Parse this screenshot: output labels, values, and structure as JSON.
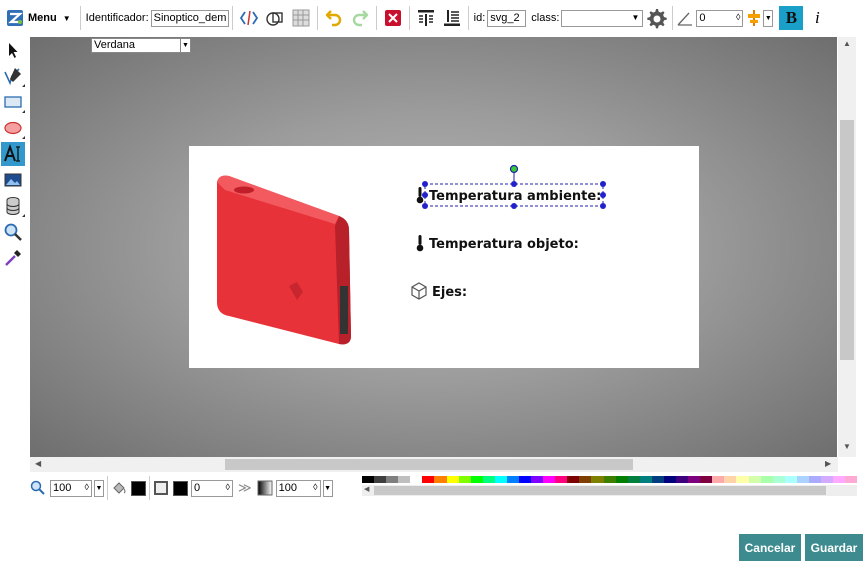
{
  "toolbar": {
    "menu_label": "Menu",
    "identifier_label": "Identificador:",
    "identifier_value": "Sinoptico_demo",
    "id_label": "id:",
    "id_value": "svg_2",
    "class_label": "class:",
    "class_value": "",
    "angle_value": "0",
    "bold_label": "B",
    "italic_label": "i"
  },
  "workarea": {
    "font_family": "Verdana"
  },
  "canvas": {
    "labels": {
      "ambient": "Temperatura ambiente:",
      "object": "Temperatura objeto:",
      "axes": "Ejes:"
    }
  },
  "bottombar": {
    "zoom_value": "100",
    "stroke_width_value": "0",
    "opacity_value": "100"
  },
  "palette": [
    "#000000",
    "#3f3f3f",
    "#7f7f7f",
    "#bfbfbf",
    "#ffffff",
    "#ff0000",
    "#ff7f00",
    "#ffff00",
    "#7fff00",
    "#00ff00",
    "#00ff7f",
    "#00ffff",
    "#007fff",
    "#0000ff",
    "#7f00ff",
    "#ff00ff",
    "#ff007f",
    "#7f0000",
    "#7f3f00",
    "#7f7f00",
    "#3f7f00",
    "#007f00",
    "#007f3f",
    "#007f7f",
    "#003f7f",
    "#00007f",
    "#3f007f",
    "#7f007f",
    "#7f003f",
    "#ffaaaa",
    "#ffd4aa",
    "#ffffaa",
    "#d4ffaa",
    "#aaffaa",
    "#aaffd4",
    "#aaffff",
    "#aad4ff",
    "#aaaaff",
    "#d4aaff",
    "#ffaaff",
    "#ffaad4"
  ],
  "dialog": {
    "cancel_label": "Cancelar",
    "save_label": "Guardar"
  }
}
